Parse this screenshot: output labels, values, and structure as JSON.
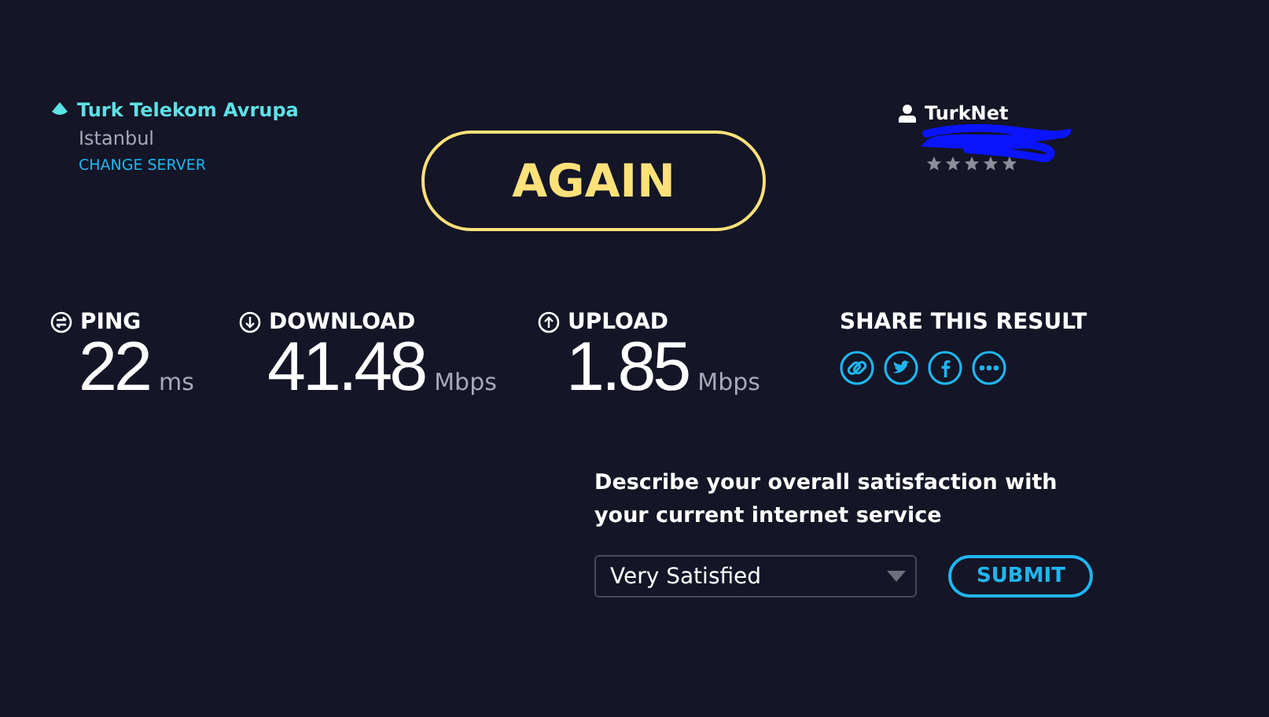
{
  "server": {
    "name": "Turk Telekom Avrupa",
    "city": "Istanbul",
    "change_link": "CHANGE SERVER"
  },
  "again_button": "AGAIN",
  "provider": {
    "name": "TurkNet"
  },
  "metrics": [
    {
      "kind": "ping",
      "label": "PING",
      "value": "22",
      "unit": "ms"
    },
    {
      "kind": "download",
      "label": "DOWNLOAD",
      "value": "41.48",
      "unit": "Mbps"
    },
    {
      "kind": "upload",
      "label": "UPLOAD",
      "value": "1.85",
      "unit": "Mbps"
    }
  ],
  "share": {
    "title": "SHARE THIS RESULT",
    "buttons": [
      {
        "kind": "link"
      },
      {
        "kind": "twitter"
      },
      {
        "kind": "facebook"
      },
      {
        "kind": "more"
      }
    ]
  },
  "survey": {
    "question": "Describe your overall satisfaction with your current internet service",
    "selection": "Very Satisfied",
    "submit": "SUBMIT"
  }
}
